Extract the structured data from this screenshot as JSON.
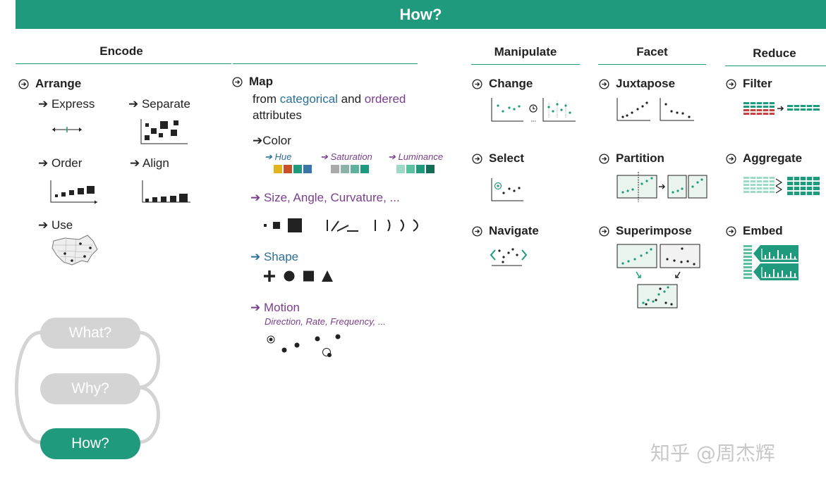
{
  "banner": {
    "title": "How?"
  },
  "headers": {
    "encode": "Encode",
    "manipulate": "Manipulate",
    "facet": "Facet",
    "reduce": "Reduce"
  },
  "arrange": {
    "label": "Arrange",
    "express": "Express",
    "separate": "Separate",
    "order": "Order",
    "align": "Align",
    "use": "Use"
  },
  "map": {
    "label": "Map",
    "line1_prefix": "from ",
    "line1_categorical": "categorical",
    "line1_and": " and ",
    "line1_ordered": "ordered",
    "line2": "attributes",
    "color": "Color",
    "hue": "Hue",
    "saturation": "Saturation",
    "luminance": "Luminance",
    "size": "Size, Angle, Curvature, ...",
    "shape": "Shape",
    "motion": "Motion",
    "motion_sub": "Direction, Rate, Frequency, ..."
  },
  "manipulate": {
    "change": "Change",
    "select": "Select",
    "navigate": "Navigate"
  },
  "facet": {
    "juxtapose": "Juxtapose",
    "partition": "Partition",
    "superimpose": "Superimpose"
  },
  "reduce": {
    "filter": "Filter",
    "aggregate": "Aggregate",
    "embed": "Embed"
  },
  "nav_cycle": {
    "what": "What?",
    "why": "Why?",
    "how": "How?"
  },
  "watermark": "知乎 @周杰辉",
  "colors": {
    "accent": "#1f9a7c",
    "purple": "#7a3e8c",
    "blue": "#2b6f96",
    "hue_swatches": [
      "#e0b51f",
      "#c8502a",
      "#1f9a7c",
      "#3a74a8"
    ],
    "saturation_swatches": [
      "#a9a9a9",
      "#8cb3a8",
      "#5fb39b",
      "#1f9a7c"
    ],
    "luminance_swatches": [
      "#9fd9c8",
      "#5cbf9f",
      "#1f9a7c",
      "#146b56"
    ],
    "pill_gray": "#d4d4d4",
    "filter_red": "#c64040"
  },
  "icons": [
    "circle-arrow-icon",
    "arrow-right-icon"
  ]
}
